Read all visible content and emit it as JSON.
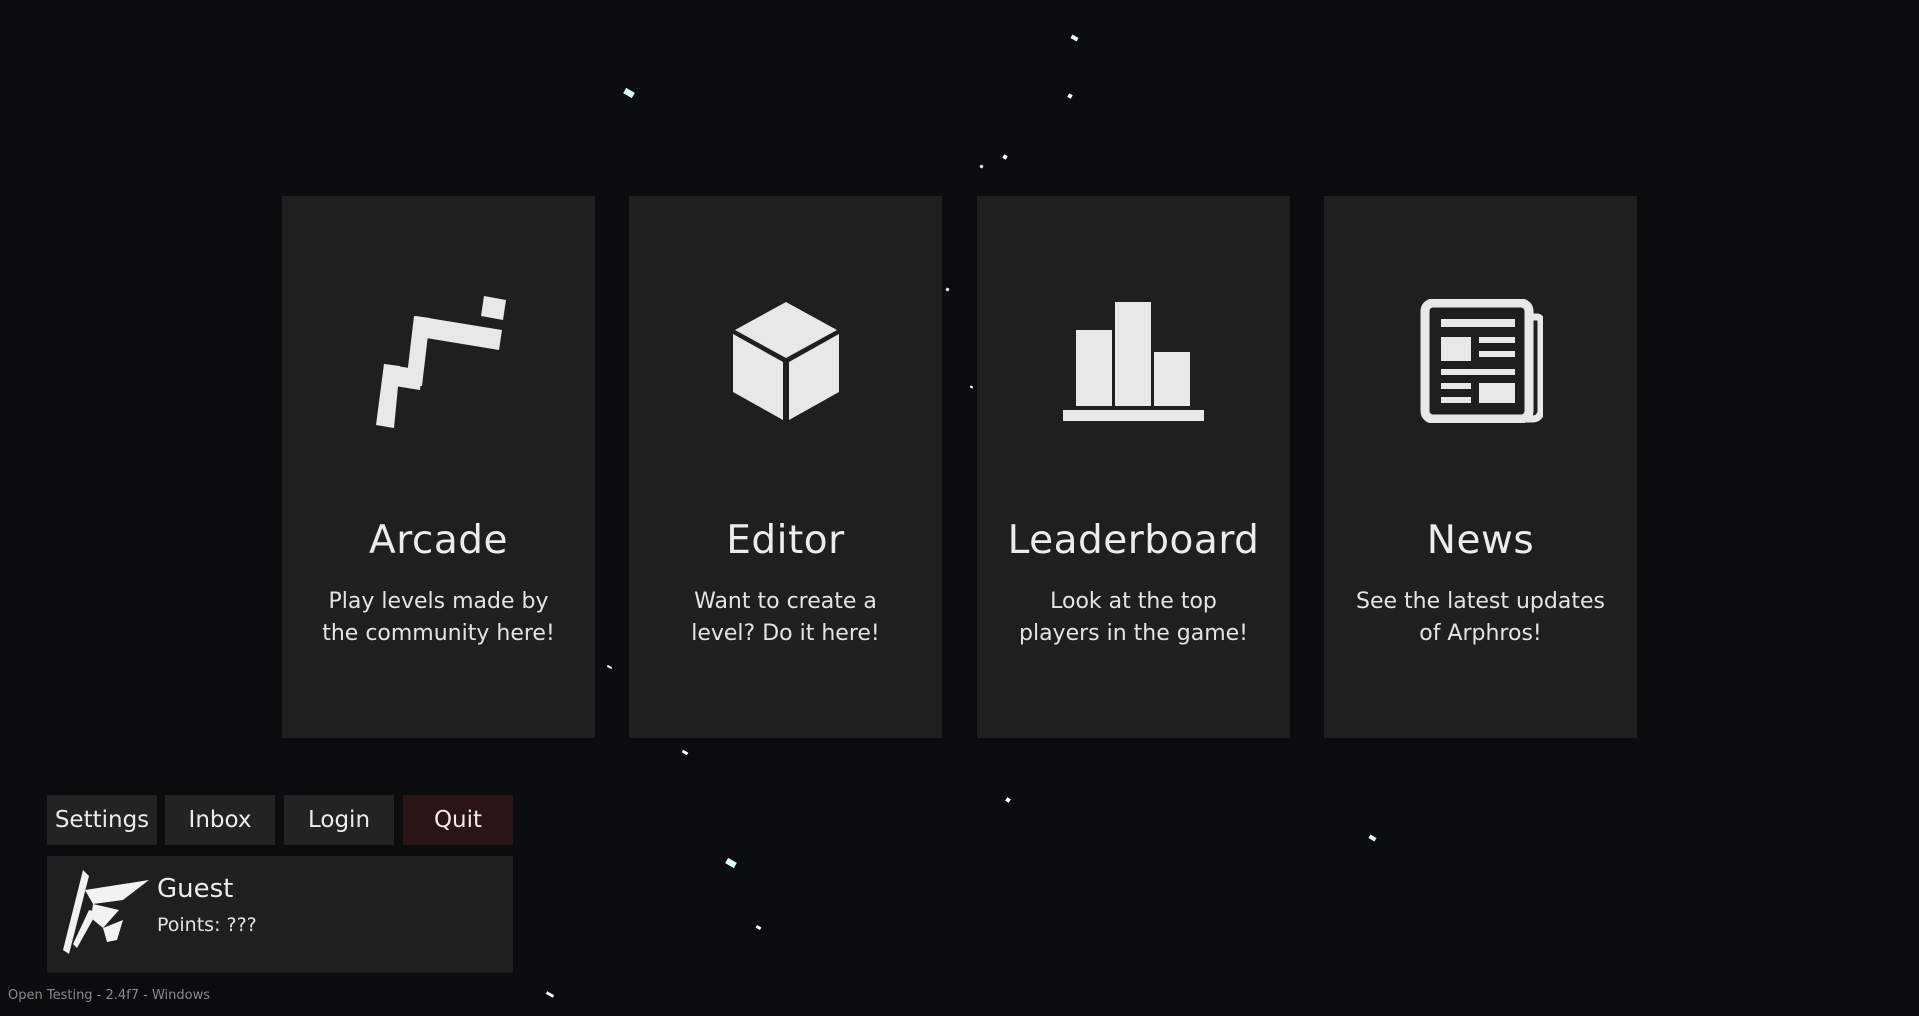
{
  "menu_cards": [
    {
      "title": "Arcade",
      "description": "Play levels made by the community here!",
      "icon": "arcade-steps-icon"
    },
    {
      "title": "Editor",
      "description": "Want to create a level? Do it here!",
      "icon": "cube-icon"
    },
    {
      "title": "Leaderboard",
      "description": "Look at the top players in the game!",
      "icon": "bar-chart-icon"
    },
    {
      "title": "News",
      "description": "See the latest updates of Arphros!",
      "icon": "newspaper-icon"
    }
  ],
  "buttons": {
    "settings": "Settings",
    "inbox": "Inbox",
    "login": "Login",
    "quit": "Quit"
  },
  "profile": {
    "name": "Guest",
    "points": "Points: ???",
    "avatar_icon": "arphros-logo-icon"
  },
  "footer": {
    "version": "Open Testing - 2.4f7 - Windows"
  },
  "colors": {
    "background": "#0b0c0e",
    "card": "#1f1f20",
    "quit_button": "#2a1416",
    "icon": "#e8e8e8"
  }
}
